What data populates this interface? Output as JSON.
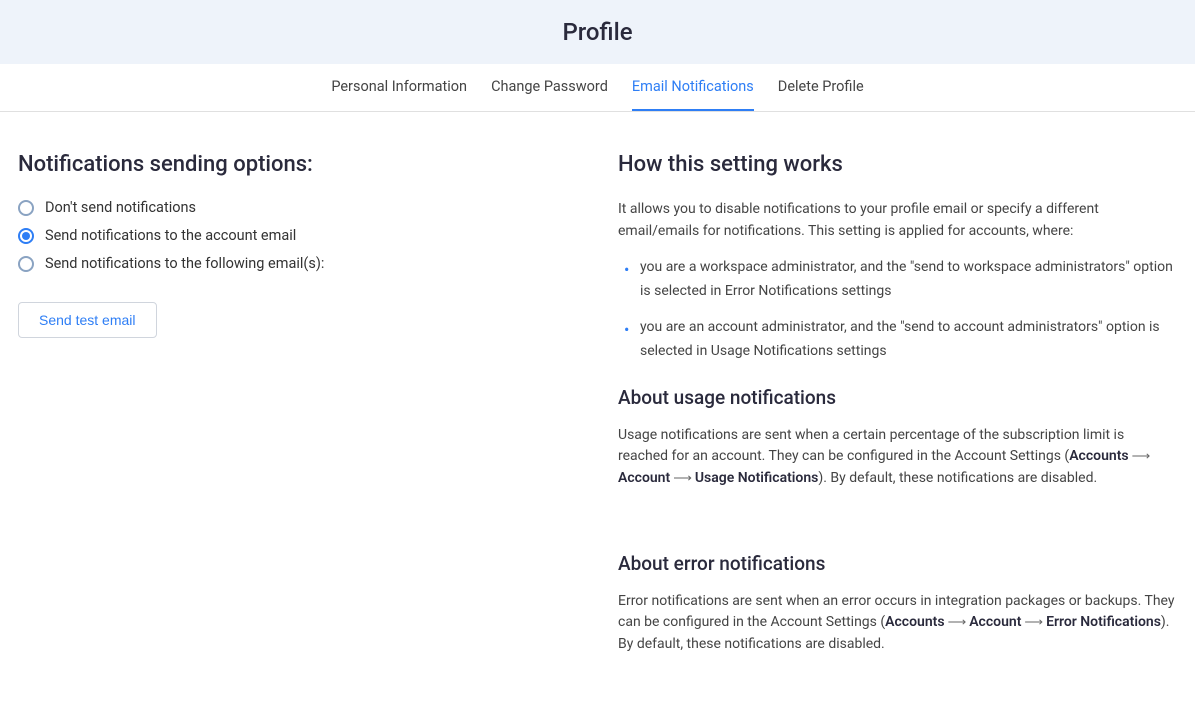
{
  "header": {
    "title": "Profile"
  },
  "tabs": [
    {
      "label": "Personal Information",
      "active": false
    },
    {
      "label": "Change Password",
      "active": false
    },
    {
      "label": "Email Notifications",
      "active": true
    },
    {
      "label": "Delete Profile",
      "active": false
    }
  ],
  "left": {
    "heading": "Notifications sending options:",
    "radios": [
      {
        "label": "Don't send notifications",
        "selected": false
      },
      {
        "label": "Send notifications to the account email",
        "selected": true
      },
      {
        "label": "Send notifications to the following email(s):",
        "selected": false
      }
    ],
    "send_test_label": "Send test email"
  },
  "right": {
    "how_heading": "How this setting works",
    "how_text": "It allows you to disable notifications to your profile email or specify a different email/emails for notifications. This setting is applied for accounts, where:",
    "bullets": [
      "you are a workspace administrator, and the \"send to workspace administrators\" option is selected in Error Notifications settings",
      "you are an account administrator, and the \"send to account administrators\" option is selected in Usage Notifications settings"
    ],
    "usage_heading": "About usage notifications",
    "usage_text_1": "Usage notifications are sent when a certain percentage of the subscription limit is reached for an account. They can be configured in the Account Settings (",
    "usage_path_1": "Accounts",
    "usage_path_2": "Account",
    "usage_path_3": "Usage Notifications",
    "usage_text_2": "). By default, these notifications are disabled.",
    "error_heading": "About error notifications",
    "error_text_1": "Error notifications are sent when an error occurs in integration packages or backups. They can be configured in the Account Settings (",
    "error_path_1": "Accounts",
    "error_path_2": "Account",
    "error_path_3": "Error Notifications",
    "error_text_2": "). By default, these notifications are disabled."
  }
}
